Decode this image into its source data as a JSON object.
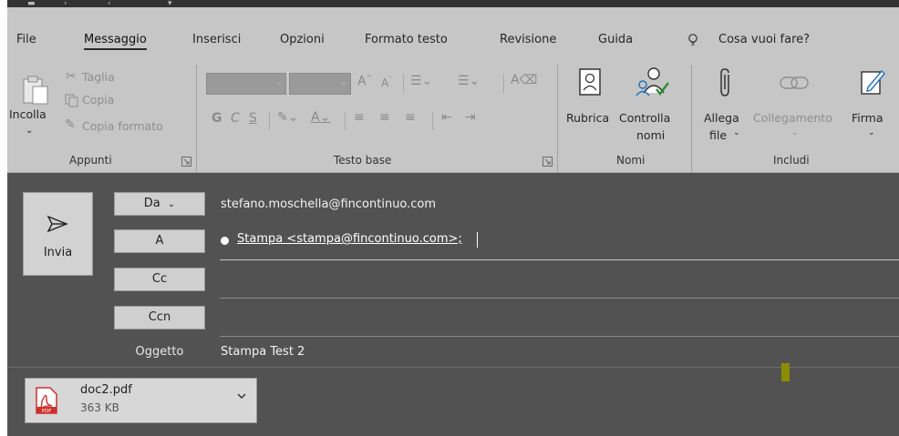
{
  "tabs": [
    {
      "label": "File"
    },
    {
      "label": "Messaggio",
      "active": true
    },
    {
      "label": "Inserisci"
    },
    {
      "label": "Opzioni"
    },
    {
      "label": "Formato testo"
    },
    {
      "label": "Revisione"
    },
    {
      "label": "Guida"
    }
  ],
  "tell_me": "Cosa vuoi fare?",
  "ribbon": {
    "clipboard": {
      "paste": "Incolla",
      "cut": "Taglia",
      "copy": "Copia",
      "format_painter": "Copia formato",
      "label": "Appunti"
    },
    "basic_text": {
      "bold": "G",
      "italic": "C",
      "underline": "S",
      "label": "Testo base"
    },
    "names": {
      "address_book": "Rubrica",
      "check_names_1": "Controlla",
      "check_names_2": "nomi",
      "label": "Nomi"
    },
    "include": {
      "attach_1": "Allega",
      "attach_2": "file",
      "link": "Collegamento",
      "signature": "Firma",
      "label": "Includi"
    }
  },
  "compose": {
    "send": "Invia",
    "from_button": "Da",
    "from_value": "stefano.moschella@fincontinuo.com",
    "to_button": "A",
    "to_recipient": "Stampa <stampa@fincontinuo.com>;",
    "cc_button": "Cc",
    "bcc_button": "Ccn",
    "subject_label": "Oggetto",
    "subject_value": "Stampa Test 2"
  },
  "attachment": {
    "name": "doc2.pdf",
    "size": "363 KB",
    "pdf_badge": "PDF"
  },
  "colors": {
    "ribbon_bg": "#c6c6c6",
    "compose_bg": "#525252",
    "pdf_red": "#d0302b"
  }
}
